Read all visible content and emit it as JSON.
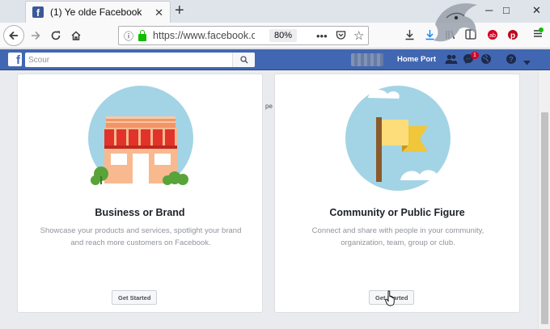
{
  "browser": {
    "tab_title": "(1) Ye olde Facebook",
    "tab_close": "✕",
    "new_tab": "+",
    "url": "https://www.facebook.com",
    "zoom": "80%",
    "window_controls": [
      "─",
      "□",
      "✕"
    ],
    "icons": [
      "back-arrow-icon",
      "forward-arrow-icon",
      "reload-icon",
      "home-icon",
      "info-icon",
      "lock-icon",
      "page-actions-icon",
      "pocket-icon",
      "bookmark-star-icon",
      "downloads-icon",
      "library-icon",
      "sidebar-icon",
      "extension-icon",
      "pinterest-icon",
      "menu-icon"
    ],
    "toolbar_badge": "1"
  },
  "facebook": {
    "logo": "f",
    "search_placeholder": "Scour",
    "home_link": "Home Port",
    "messenger_badge": "1",
    "accent": "#4267b2"
  },
  "cards": [
    {
      "title": "Business or Brand",
      "description": "Showcase your products and services, spotlight your brand and reach more customers on Facebook.",
      "button": "Get Started"
    },
    {
      "title": "Community or Public Figure",
      "description": "Connect and share with people in your community, organization, team, group or club.",
      "button": "Get Started"
    }
  ],
  "stray_text": "pe"
}
